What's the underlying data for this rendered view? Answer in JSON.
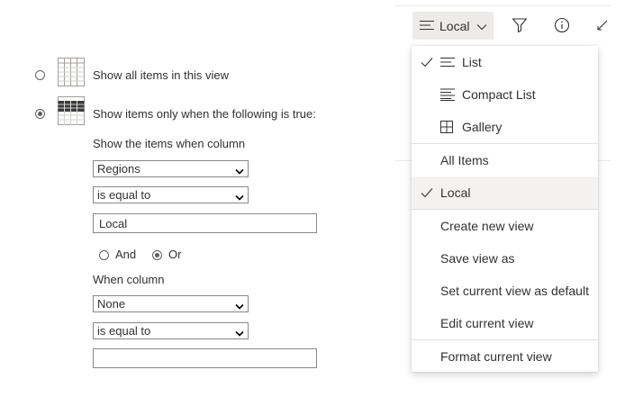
{
  "toolbar": {
    "view_label": "Local",
    "icons": [
      "list-lines-icon",
      "chevron-down-icon",
      "filter-icon",
      "info-icon",
      "expand-icon"
    ]
  },
  "filter_panel": {
    "option_all": "Show all items in this view",
    "option_conditional": "Show items only when the following is true:",
    "show_items_when_column": "Show the items when column",
    "column1_value": "Regions",
    "operator1_value": "is equal to",
    "value1": "Local",
    "and_label": "And",
    "or_label": "Or",
    "when_column": "When column",
    "column2_value": "None",
    "operator2_value": "is equal to",
    "value2": ""
  },
  "menu": {
    "layouts": [
      {
        "label": "List",
        "checked": true,
        "icon": "list-icon"
      },
      {
        "label": "Compact List",
        "checked": false,
        "icon": "compact-list-icon"
      },
      {
        "label": "Gallery",
        "checked": false,
        "icon": "gallery-icon"
      }
    ],
    "views": [
      {
        "label": "All Items",
        "checked": false
      },
      {
        "label": "Local",
        "checked": true
      }
    ],
    "actions": [
      {
        "label": "Create new view"
      },
      {
        "label": "Save view as"
      },
      {
        "label": "Set current view as default"
      },
      {
        "label": "Edit current view"
      }
    ],
    "format": "Format current view"
  },
  "colors": {
    "button_bg": "#edebe9",
    "menu_selected_bg": "#f3f2f1",
    "text": "#323130"
  }
}
